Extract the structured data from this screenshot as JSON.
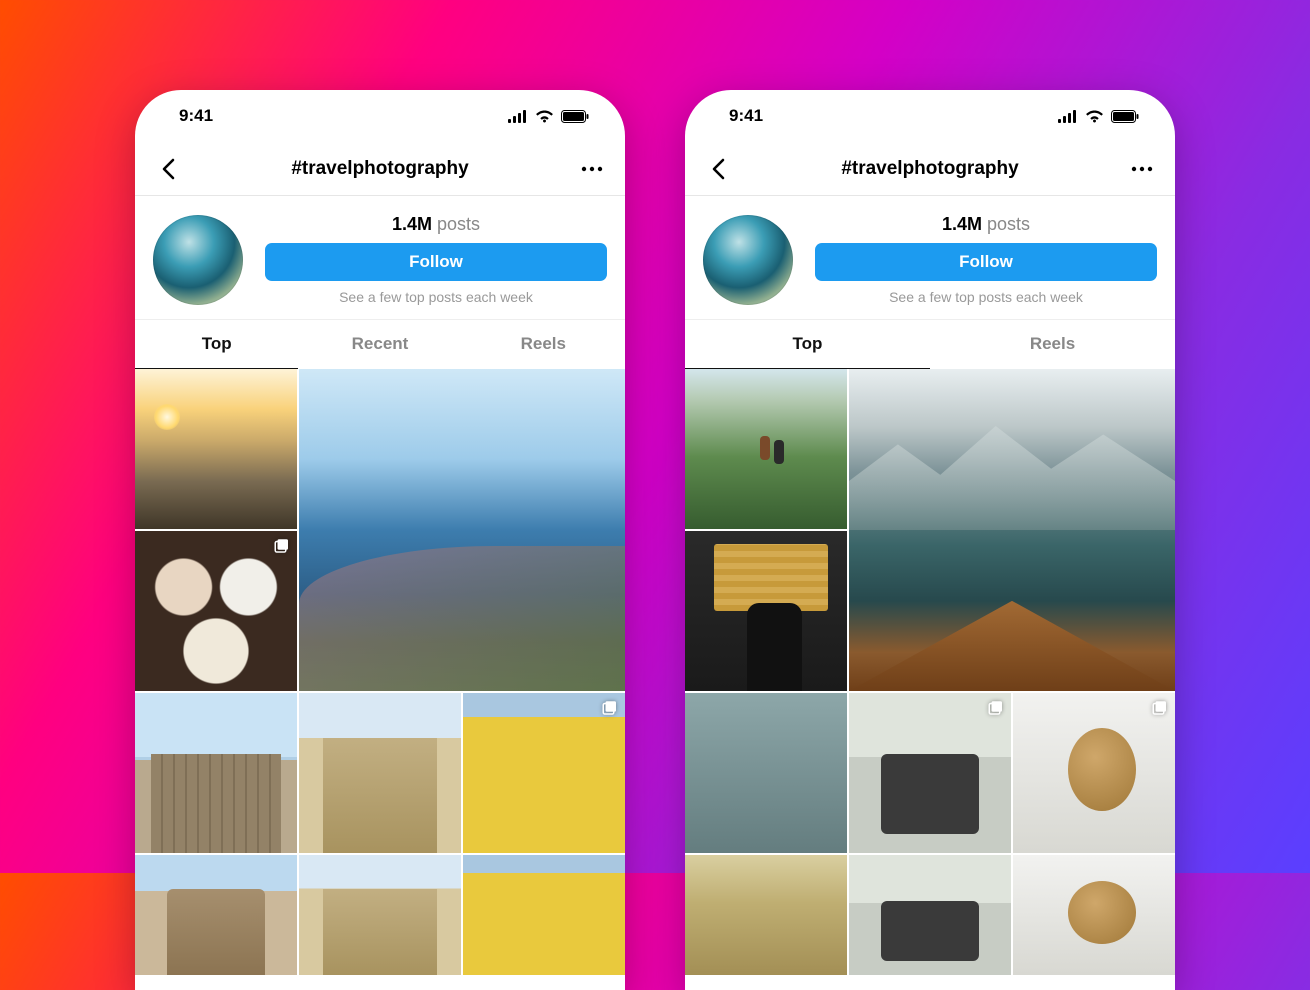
{
  "status_time": "9:41",
  "hashtag": {
    "title": "#travelphotography",
    "post_count": "1.4M",
    "post_label": "posts",
    "follow_label": "Follow",
    "hint": "See a few top posts each week"
  },
  "phone_a": {
    "tabs": [
      {
        "label": "Top",
        "active": true
      },
      {
        "label": "Recent",
        "active": false
      },
      {
        "label": "Reels",
        "active": false
      }
    ],
    "posts": [
      {
        "name": "desert-sunset",
        "stack": false
      },
      {
        "name": "coastline-flowers",
        "stack": false,
        "featured": true
      },
      {
        "name": "breakfast-table",
        "stack": true
      },
      {
        "name": "old-building",
        "stack": false
      },
      {
        "name": "roman-arch",
        "stack": false
      },
      {
        "name": "yellow-wall",
        "stack": true
      },
      {
        "name": "ruins",
        "stack": false
      },
      {
        "name": "arches",
        "stack": false
      },
      {
        "name": "street",
        "stack": false
      }
    ]
  },
  "phone_b": {
    "tabs": [
      {
        "label": "Top",
        "active": true
      },
      {
        "label": "Reels",
        "active": false
      }
    ],
    "posts": [
      {
        "name": "alpine-hikers",
        "stack": false
      },
      {
        "name": "mountain-lake-boat",
        "stack": false,
        "featured": true
      },
      {
        "name": "airport-departures",
        "stack": false
      },
      {
        "name": "pipes",
        "stack": false
      },
      {
        "name": "market",
        "stack": false
      },
      {
        "name": "open-suitcase",
        "stack": true
      },
      {
        "name": "globe-window",
        "stack": true
      },
      {
        "name": "extra1",
        "stack": false
      },
      {
        "name": "extra2",
        "stack": false
      }
    ]
  }
}
